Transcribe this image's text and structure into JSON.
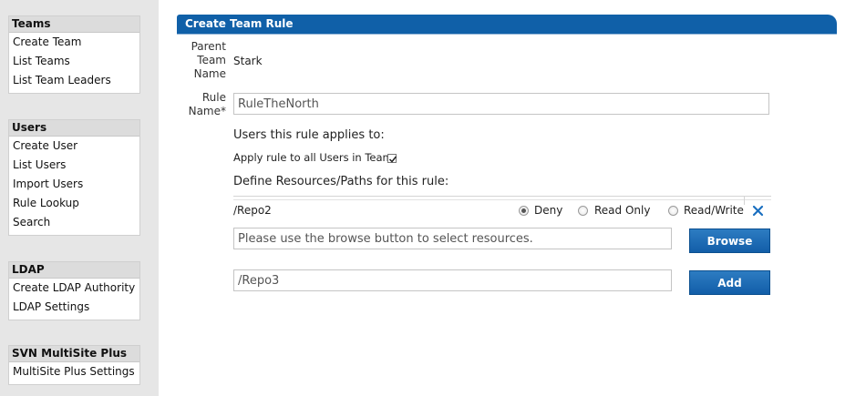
{
  "sidebar": {
    "sections": [
      {
        "title": "Teams",
        "items": [
          "Create Team",
          "List Teams",
          "List Team Leaders"
        ]
      },
      {
        "title": "Users",
        "items": [
          "Create User",
          "List Users",
          "Import Users",
          "Rule Lookup",
          "Search"
        ]
      },
      {
        "title": "LDAP",
        "items": [
          "Create LDAP Authority",
          "LDAP Settings"
        ]
      },
      {
        "title": "SVN MultiSite Plus",
        "items": [
          "MultiSite Plus Settings"
        ]
      }
    ]
  },
  "panel": {
    "title": "Create Team Rule",
    "parent_label_lines": [
      "Parent",
      "Team",
      "Name"
    ],
    "parent_value": "Stark",
    "rule_label_lines": [
      "Rule",
      "Name*"
    ],
    "rule_name_value": "RuleTheNorth",
    "users_heading": "Users this rule applies to:",
    "apply_all_label": "Apply rule to all Users in Team",
    "apply_all_checked": true,
    "resources_heading": "Define Resources/Paths for this rule:",
    "resource_row": {
      "path": "/Repo2",
      "options": [
        "Deny",
        "Read Only",
        "Read/Write"
      ],
      "selected": "Deny"
    },
    "browse_placeholder": "Please use the browse button to select resources.",
    "browse_button": "Browse",
    "add_path_value": "/Repo3",
    "add_button": "Add"
  },
  "colors": {
    "header_blue": "#1060a8",
    "button_blue": "#125ea8",
    "close_icon_blue": "#1a6fc0",
    "sidebar_bg": "#e6e6e6"
  }
}
